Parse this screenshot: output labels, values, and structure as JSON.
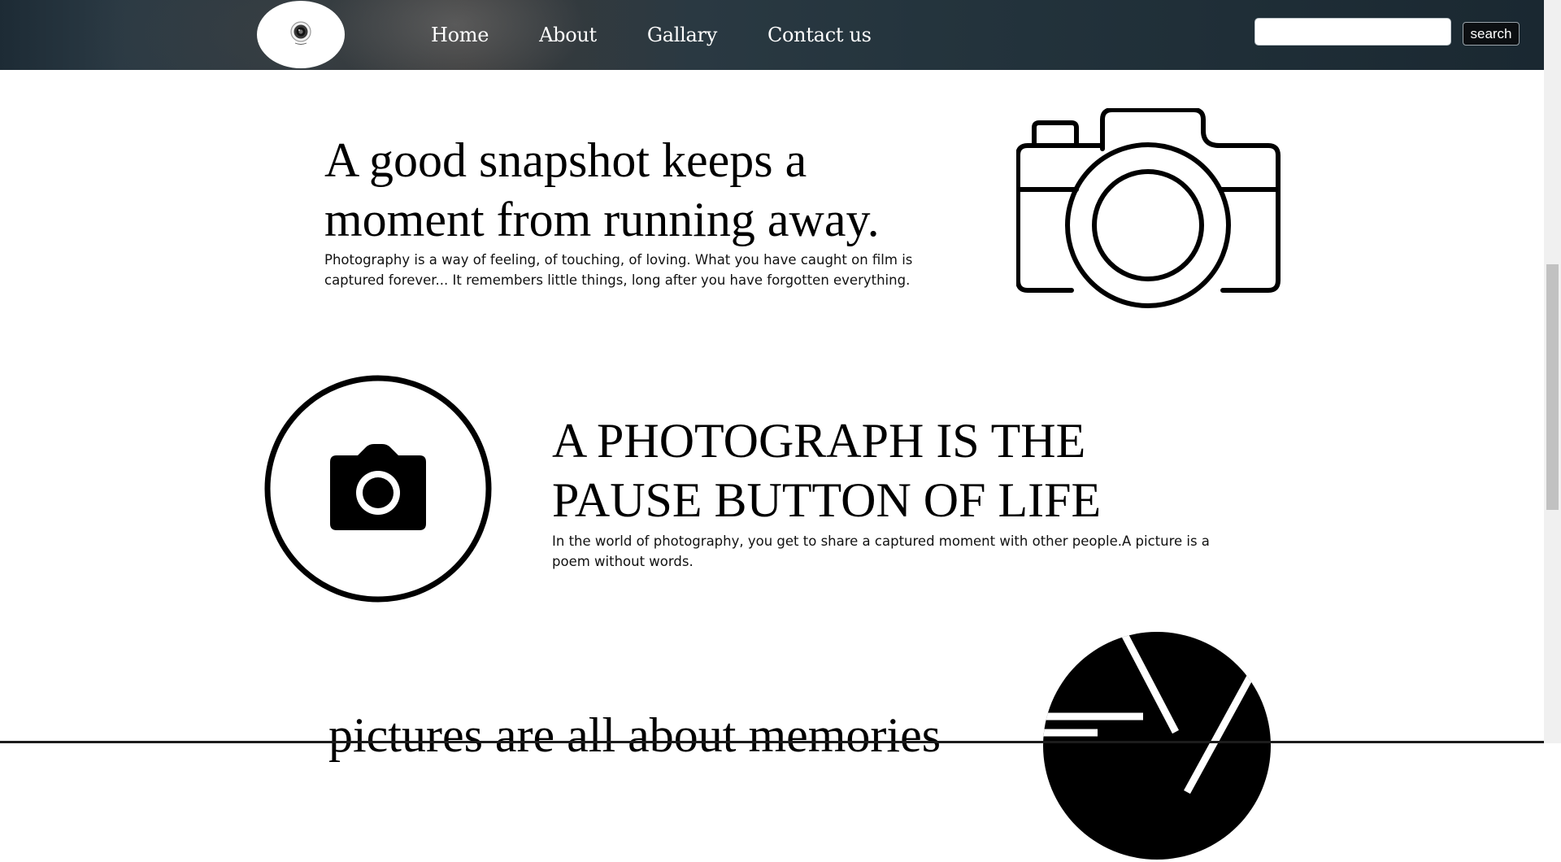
{
  "nav": {
    "logo_icon": "camera-lens-icon",
    "links": [
      "Home",
      "About",
      "Gallary",
      "Contact us"
    ],
    "search": {
      "value": "",
      "placeholder": "",
      "button_label": "search"
    }
  },
  "sections": [
    {
      "heading": "A good snapshot keeps a moment from running away.",
      "text": "Photography is a way of feeling, of touching, of loving. What you have caught on film is captured forever... It remembers little things, long after you have forgotten everything.",
      "image_icon": "camera-outline-icon"
    },
    {
      "heading": "A PHOTOGRAPH IS THE PAUSE BUTTON OF LIFE",
      "text": "In the world of photography, you get to share a captured moment with other people.A picture is a poem without words.",
      "image_icon": "camera-circle-icon"
    },
    {
      "heading": "pictures are all about memories",
      "image_icon": "aperture-icon"
    }
  ],
  "colors": {
    "nav_background": "#24343d",
    "nav_text": "#ffffff",
    "page_background": "#ffffff",
    "search_button": "#0c0f12"
  }
}
